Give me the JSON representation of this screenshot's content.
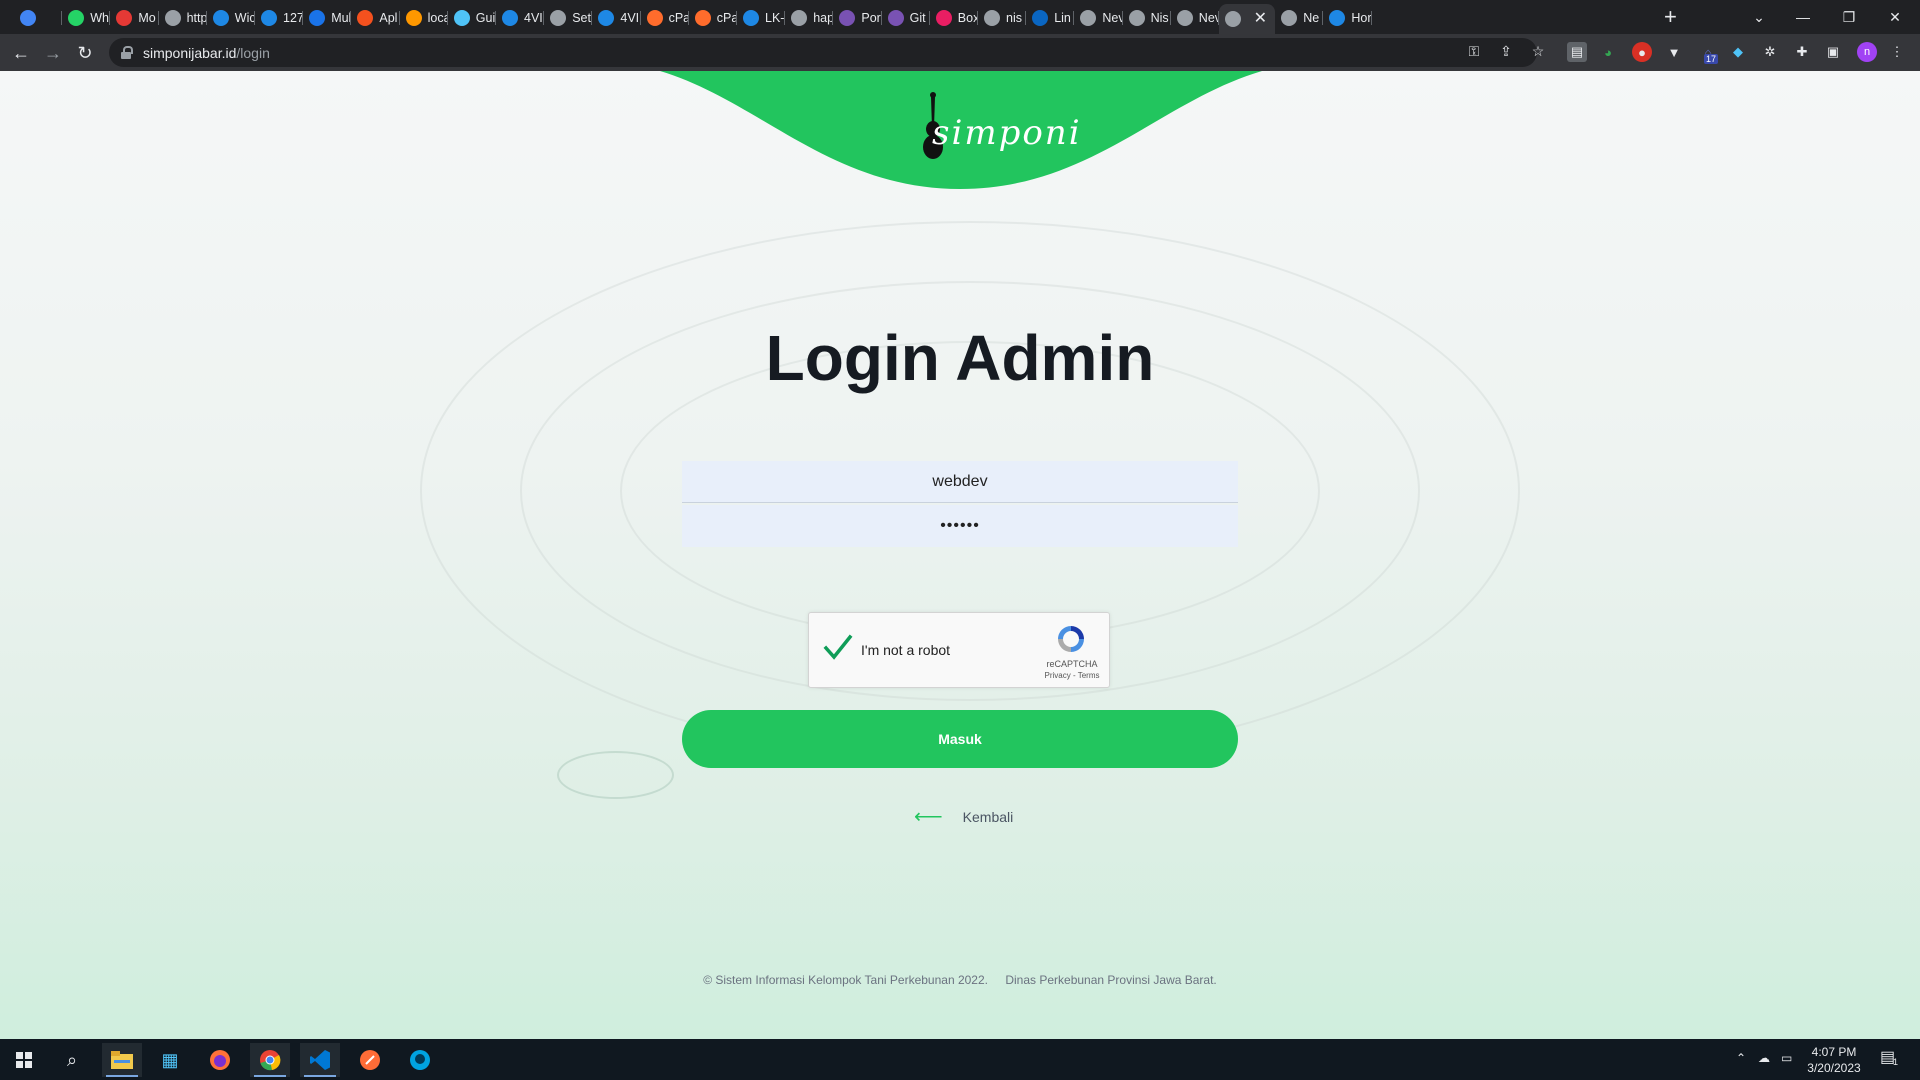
{
  "browser": {
    "tabs": [
      {
        "label": "",
        "color": "#4285f4"
      },
      {
        "label": "Wh",
        "color": "#25d366"
      },
      {
        "label": "Mo",
        "color": "#e53935"
      },
      {
        "label": "http",
        "color": "#9aa0a6"
      },
      {
        "label": "Wic",
        "color": "#1e88e5"
      },
      {
        "label": "127",
        "color": "#1e88e5"
      },
      {
        "label": "Mul",
        "color": "#1a73e8"
      },
      {
        "label": "Apl",
        "color": "#f4511e"
      },
      {
        "label": "loca",
        "color": "#ff9800"
      },
      {
        "label": "Gui",
        "color": "#4fc3f7"
      },
      {
        "label": "4VI",
        "color": "#1e88e5"
      },
      {
        "label": "Set",
        "color": "#9aa0a6"
      },
      {
        "label": "4VI",
        "color": "#1e88e5"
      },
      {
        "label": "cPa",
        "color": "#ff6c2c"
      },
      {
        "label": "cPa",
        "color": "#ff6c2c"
      },
      {
        "label": "LK-",
        "color": "#1e88e5"
      },
      {
        "label": "hap",
        "color": "#9aa0a6"
      },
      {
        "label": "Por",
        "color": "#7952b3"
      },
      {
        "label": "Git",
        "color": "#7952b3"
      },
      {
        "label": "Box",
        "color": "#e91e63"
      },
      {
        "label": "nis",
        "color": "#9aa0a6"
      },
      {
        "label": "Lin",
        "color": "#0a66c2"
      },
      {
        "label": "Nev",
        "color": "#9aa0a6"
      },
      {
        "label": "Nis",
        "color": "#9aa0a6"
      },
      {
        "label": "Nev",
        "color": "#9aa0a6"
      },
      {
        "label": "",
        "color": "#9aa0a6",
        "active": true
      },
      {
        "label": "Ne",
        "color": "#9aa0a6"
      },
      {
        "label": "Hor",
        "color": "#1e88e5"
      }
    ],
    "url_host": "simponijabar.id",
    "url_path": "/login",
    "extension_badge": "17",
    "profile_initial": "n"
  },
  "page": {
    "logo_text": "simponi",
    "title": "Login Admin",
    "username_value": "webdev",
    "password_value": "••••••",
    "captcha_label": "I'm not a robot",
    "captcha_brand": "reCAPTCHA",
    "captcha_links": "Privacy - Terms",
    "submit_label": "Masuk",
    "back_label": "Kembali",
    "footer_left": "© Sistem Informasi Kelompok Tani Perkebunan 2022.",
    "footer_right": "Dinas Perkebunan Provinsi Jawa Barat.",
    "accent_color": "#22c55e"
  },
  "taskbar": {
    "time": "4:07 PM",
    "date": "3/20/2023",
    "notification_count": "1"
  }
}
